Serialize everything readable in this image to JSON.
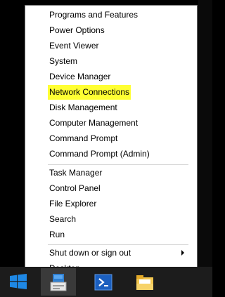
{
  "menu": {
    "group1": [
      {
        "label": "Programs and Features"
      },
      {
        "label": "Power Options"
      },
      {
        "label": "Event Viewer"
      },
      {
        "label": "System"
      },
      {
        "label": "Device Manager"
      },
      {
        "label": "Network Connections",
        "highlighted": true
      },
      {
        "label": "Disk Management"
      },
      {
        "label": "Computer Management"
      },
      {
        "label": "Command Prompt"
      },
      {
        "label": "Command Prompt (Admin)"
      }
    ],
    "group2": [
      {
        "label": "Task Manager"
      },
      {
        "label": "Control Panel"
      },
      {
        "label": "File Explorer"
      },
      {
        "label": "Search"
      },
      {
        "label": "Run"
      }
    ],
    "group3": [
      {
        "label": "Shut down or sign out",
        "has_submenu": true
      },
      {
        "label": "Desktop"
      }
    ],
    "highlight_color": "#ffff33"
  },
  "taskbar": {
    "start_icon": "windows-logo-icon",
    "apps": [
      {
        "icon": "server-manager-icon",
        "active": true
      },
      {
        "icon": "powershell-icon",
        "active": false
      },
      {
        "icon": "file-explorer-icon",
        "active": false
      }
    ],
    "accent_color": "#1e88e5"
  }
}
